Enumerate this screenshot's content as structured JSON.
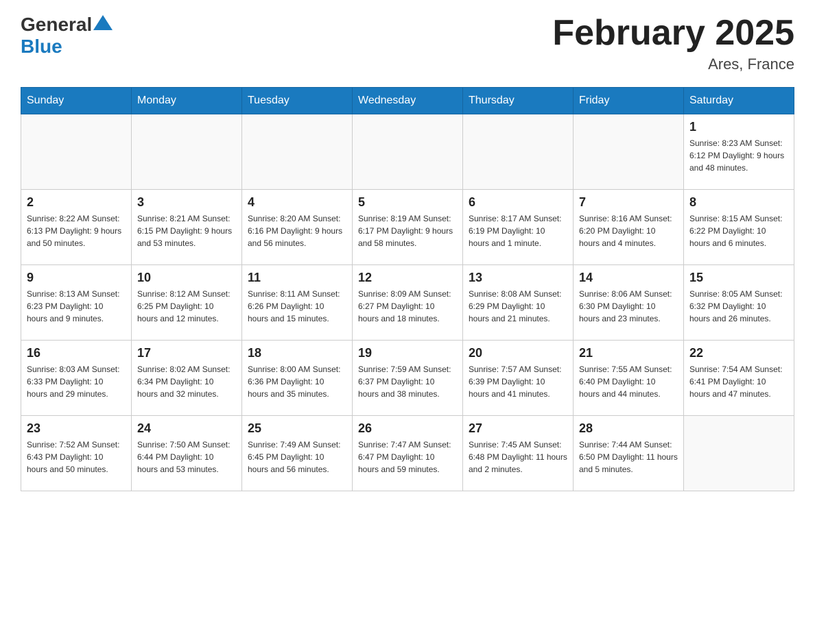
{
  "header": {
    "logo_general": "General",
    "logo_blue": "Blue",
    "month_title": "February 2025",
    "location": "Ares, France"
  },
  "weekdays": [
    "Sunday",
    "Monday",
    "Tuesday",
    "Wednesday",
    "Thursday",
    "Friday",
    "Saturday"
  ],
  "weeks": [
    [
      {
        "day": "",
        "info": ""
      },
      {
        "day": "",
        "info": ""
      },
      {
        "day": "",
        "info": ""
      },
      {
        "day": "",
        "info": ""
      },
      {
        "day": "",
        "info": ""
      },
      {
        "day": "",
        "info": ""
      },
      {
        "day": "1",
        "info": "Sunrise: 8:23 AM\nSunset: 6:12 PM\nDaylight: 9 hours and 48 minutes."
      }
    ],
    [
      {
        "day": "2",
        "info": "Sunrise: 8:22 AM\nSunset: 6:13 PM\nDaylight: 9 hours and 50 minutes."
      },
      {
        "day": "3",
        "info": "Sunrise: 8:21 AM\nSunset: 6:15 PM\nDaylight: 9 hours and 53 minutes."
      },
      {
        "day": "4",
        "info": "Sunrise: 8:20 AM\nSunset: 6:16 PM\nDaylight: 9 hours and 56 minutes."
      },
      {
        "day": "5",
        "info": "Sunrise: 8:19 AM\nSunset: 6:17 PM\nDaylight: 9 hours and 58 minutes."
      },
      {
        "day": "6",
        "info": "Sunrise: 8:17 AM\nSunset: 6:19 PM\nDaylight: 10 hours and 1 minute."
      },
      {
        "day": "7",
        "info": "Sunrise: 8:16 AM\nSunset: 6:20 PM\nDaylight: 10 hours and 4 minutes."
      },
      {
        "day": "8",
        "info": "Sunrise: 8:15 AM\nSunset: 6:22 PM\nDaylight: 10 hours and 6 minutes."
      }
    ],
    [
      {
        "day": "9",
        "info": "Sunrise: 8:13 AM\nSunset: 6:23 PM\nDaylight: 10 hours and 9 minutes."
      },
      {
        "day": "10",
        "info": "Sunrise: 8:12 AM\nSunset: 6:25 PM\nDaylight: 10 hours and 12 minutes."
      },
      {
        "day": "11",
        "info": "Sunrise: 8:11 AM\nSunset: 6:26 PM\nDaylight: 10 hours and 15 minutes."
      },
      {
        "day": "12",
        "info": "Sunrise: 8:09 AM\nSunset: 6:27 PM\nDaylight: 10 hours and 18 minutes."
      },
      {
        "day": "13",
        "info": "Sunrise: 8:08 AM\nSunset: 6:29 PM\nDaylight: 10 hours and 21 minutes."
      },
      {
        "day": "14",
        "info": "Sunrise: 8:06 AM\nSunset: 6:30 PM\nDaylight: 10 hours and 23 minutes."
      },
      {
        "day": "15",
        "info": "Sunrise: 8:05 AM\nSunset: 6:32 PM\nDaylight: 10 hours and 26 minutes."
      }
    ],
    [
      {
        "day": "16",
        "info": "Sunrise: 8:03 AM\nSunset: 6:33 PM\nDaylight: 10 hours and 29 minutes."
      },
      {
        "day": "17",
        "info": "Sunrise: 8:02 AM\nSunset: 6:34 PM\nDaylight: 10 hours and 32 minutes."
      },
      {
        "day": "18",
        "info": "Sunrise: 8:00 AM\nSunset: 6:36 PM\nDaylight: 10 hours and 35 minutes."
      },
      {
        "day": "19",
        "info": "Sunrise: 7:59 AM\nSunset: 6:37 PM\nDaylight: 10 hours and 38 minutes."
      },
      {
        "day": "20",
        "info": "Sunrise: 7:57 AM\nSunset: 6:39 PM\nDaylight: 10 hours and 41 minutes."
      },
      {
        "day": "21",
        "info": "Sunrise: 7:55 AM\nSunset: 6:40 PM\nDaylight: 10 hours and 44 minutes."
      },
      {
        "day": "22",
        "info": "Sunrise: 7:54 AM\nSunset: 6:41 PM\nDaylight: 10 hours and 47 minutes."
      }
    ],
    [
      {
        "day": "23",
        "info": "Sunrise: 7:52 AM\nSunset: 6:43 PM\nDaylight: 10 hours and 50 minutes."
      },
      {
        "day": "24",
        "info": "Sunrise: 7:50 AM\nSunset: 6:44 PM\nDaylight: 10 hours and 53 minutes."
      },
      {
        "day": "25",
        "info": "Sunrise: 7:49 AM\nSunset: 6:45 PM\nDaylight: 10 hours and 56 minutes."
      },
      {
        "day": "26",
        "info": "Sunrise: 7:47 AM\nSunset: 6:47 PM\nDaylight: 10 hours and 59 minutes."
      },
      {
        "day": "27",
        "info": "Sunrise: 7:45 AM\nSunset: 6:48 PM\nDaylight: 11 hours and 2 minutes."
      },
      {
        "day": "28",
        "info": "Sunrise: 7:44 AM\nSunset: 6:50 PM\nDaylight: 11 hours and 5 minutes."
      },
      {
        "day": "",
        "info": ""
      }
    ]
  ]
}
